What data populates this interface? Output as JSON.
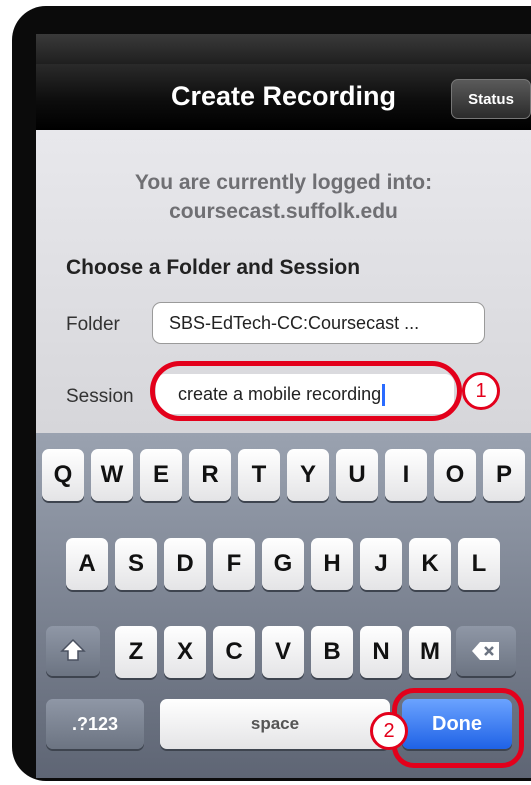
{
  "nav": {
    "title": "Create Recording",
    "status_button": "Status"
  },
  "content": {
    "logged_in_line1": "You are currently logged into:",
    "logged_in_line2": "coursecast.suffolk.edu",
    "section_title": "Choose a Folder and Session",
    "folder_label": "Folder",
    "folder_value": "SBS-EdTech-CC:Coursecast ...",
    "session_label": "Session",
    "session_value": "create a mobile recording"
  },
  "annotations": {
    "badge_1": "1",
    "badge_2": "2"
  },
  "keyboard": {
    "row1": [
      "Q",
      "W",
      "E",
      "R",
      "T",
      "Y",
      "U",
      "I",
      "O",
      "P"
    ],
    "row2": [
      "A",
      "S",
      "D",
      "F",
      "G",
      "H",
      "J",
      "K",
      "L"
    ],
    "row3": [
      "Z",
      "X",
      "C",
      "V",
      "B",
      "N",
      "M"
    ],
    "numbers_key": ".?123",
    "space_key": "space",
    "done_key": "Done",
    "shift_icon": "shift-icon",
    "backspace_icon": "backspace-icon"
  },
  "colors": {
    "highlight": "#e3001b",
    "done_blue": "#1f62e6"
  }
}
